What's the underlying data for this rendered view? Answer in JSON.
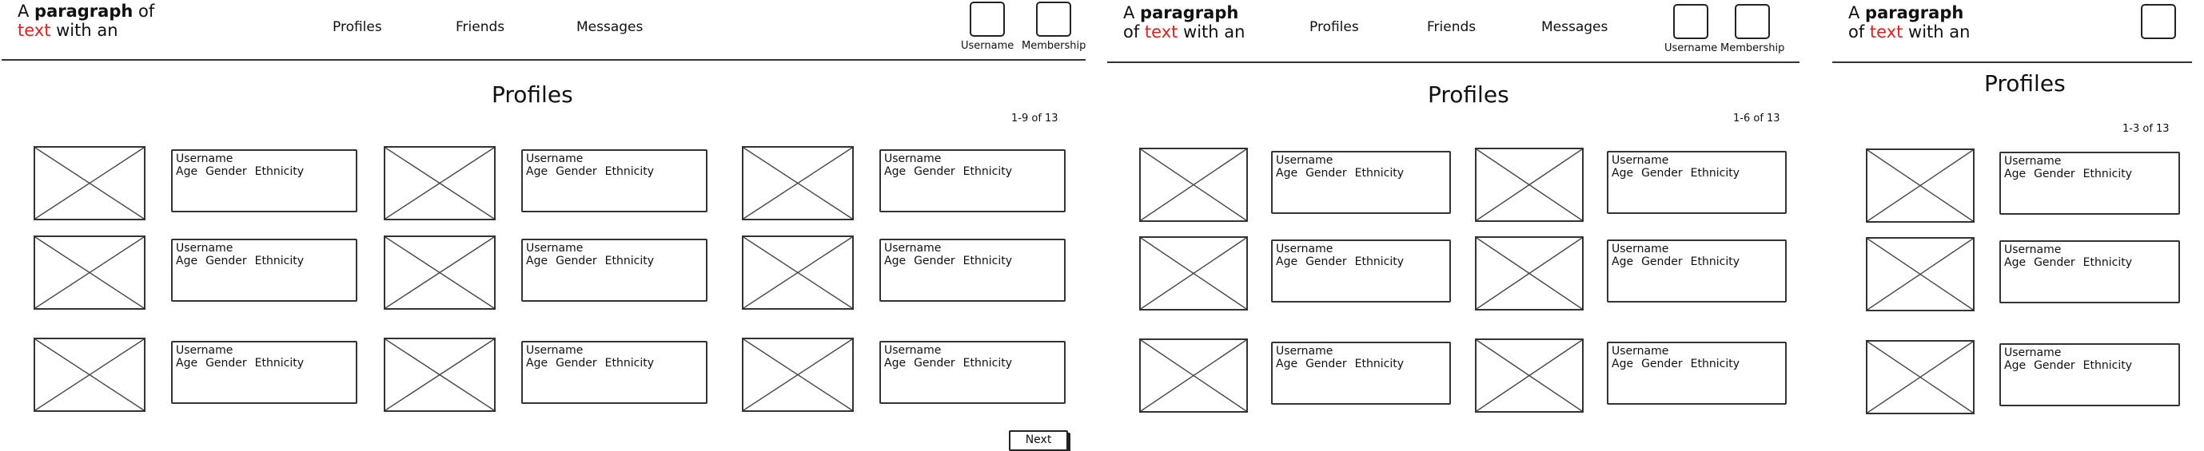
{
  "header": {
    "logo": {
      "prefix": "A ",
      "bold": "paragraph",
      "after_bold": " of",
      "red": "text",
      "after_red": " with an"
    },
    "logo_p2": {
      "prefix": "A ",
      "bold": "paragraph",
      "line2_prefix": "of ",
      "red": "text",
      "after_red": " with an"
    },
    "nav": [
      "Profiles",
      "Friends",
      "Messages"
    ],
    "username_label": "Username",
    "membership_label": "Membership"
  },
  "page": {
    "title": "Profiles",
    "count_desktop": "1-9 of 13",
    "count_tablet": "1-6 of 13",
    "count_mobile": "1-3 of 13",
    "next_label": "Next"
  },
  "profile_card": {
    "username": "Username",
    "age": "Age",
    "gender": "Gender",
    "ethnicity": "Ethnicity"
  },
  "icons": {
    "thumbnail": "image-placeholder-icon"
  }
}
